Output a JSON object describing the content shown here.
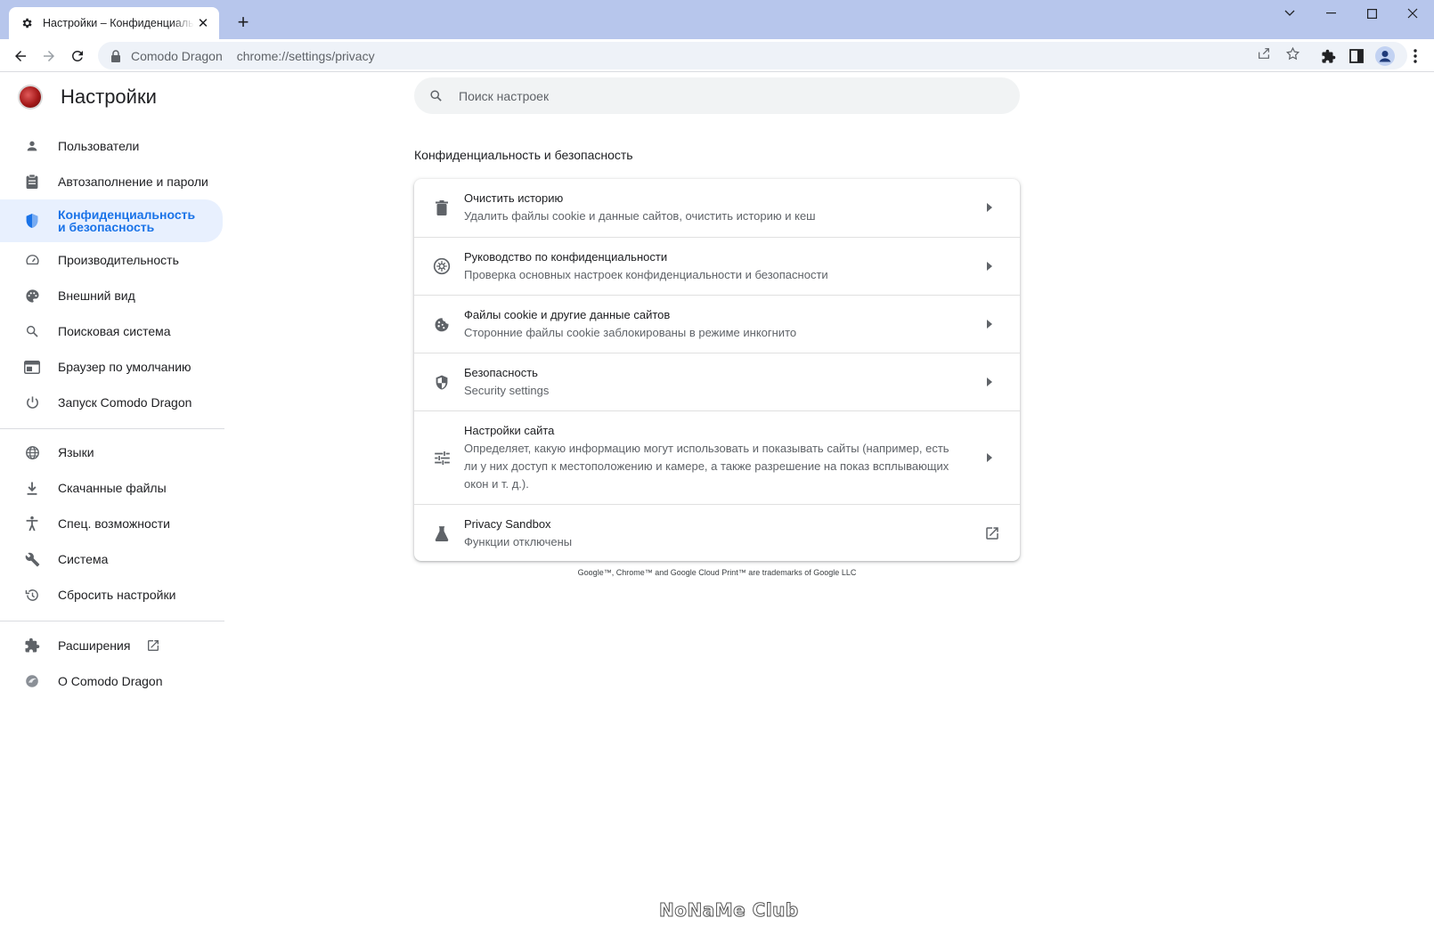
{
  "browser": {
    "tab": {
      "title": "Настройки – Конфиденциальность и безопасность",
      "icon": "gear-icon"
    },
    "window_controls": [
      "chevron-down-icon",
      "minimize-icon",
      "maximize-icon",
      "close-icon"
    ],
    "omnibox": {
      "site_chip": "Comodo Dragon",
      "url": "chrome://settings/privacy"
    }
  },
  "settings": {
    "title": "Настройки",
    "search": {
      "placeholder": "Поиск настроек"
    },
    "sidebar": {
      "group1": [
        {
          "label": "Пользователи",
          "icon": "person-icon"
        },
        {
          "label": "Автозаполнение и пароли",
          "icon": "clipboard-icon"
        },
        {
          "label": "Конфиденциальность и безопасность",
          "icon": "shield-icon",
          "active": true
        },
        {
          "label": "Производительность",
          "icon": "speedometer-icon"
        },
        {
          "label": "Внешний вид",
          "icon": "palette-icon"
        },
        {
          "label": "Поисковая система",
          "icon": "search-icon"
        },
        {
          "label": "Браузер по умолчанию",
          "icon": "browser-window-icon"
        },
        {
          "label": "Запуск Comodo Dragon",
          "icon": "power-icon"
        }
      ],
      "group2": [
        {
          "label": "Языки",
          "icon": "globe-icon"
        },
        {
          "label": "Скачанные файлы",
          "icon": "download-icon"
        },
        {
          "label": "Спец. возможности",
          "icon": "accessibility-icon"
        },
        {
          "label": "Система",
          "icon": "wrench-icon"
        },
        {
          "label": "Сбросить настройки",
          "icon": "history-icon"
        }
      ],
      "group3": [
        {
          "label": "Расширения",
          "icon": "puzzle-icon",
          "external": true
        },
        {
          "label": "О Comodo Dragon",
          "icon": "dragon-logo-icon"
        }
      ]
    },
    "section": {
      "title": "Конфиденциальность и безопасность",
      "rows": [
        {
          "title": "Очистить историю",
          "subtitle": "Удалить файлы cookie и данные сайтов, очистить историю и кеш",
          "icon": "trash-icon"
        },
        {
          "title": "Руководство по конфиденциальности",
          "subtitle": "Проверка основных настроек конфиденциальности и безопасности",
          "icon": "compass-icon"
        },
        {
          "title": "Файлы cookie и другие данные сайтов",
          "subtitle": "Сторонние файлы cookie заблокированы в режиме инкогнито",
          "icon": "cookie-icon"
        },
        {
          "title": "Безопасность",
          "subtitle": "Security settings",
          "icon": "security-shield-icon"
        },
        {
          "title": "Настройки сайта",
          "subtitle": "Определяет, какую информацию могут использовать и показывать сайты (например, есть ли у них доступ к местоположению и камере, а также разрешение на показ всплывающих окон и т. д.).",
          "icon": "sliders-icon"
        },
        {
          "title": "Privacy Sandbox",
          "subtitle": "Функции отключены",
          "icon": "flask-icon"
        }
      ]
    },
    "footer": "Google™, Chrome™ and Google Cloud Print™ are trademarks of Google LLC"
  },
  "watermark": "NoNaMe Club"
}
